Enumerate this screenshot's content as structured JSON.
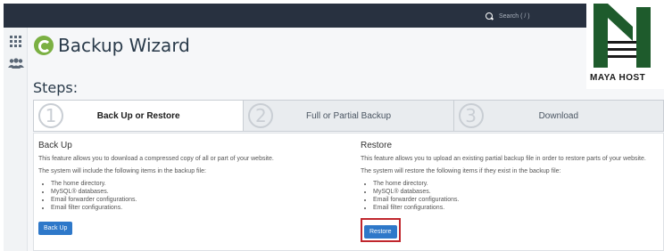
{
  "search": {
    "placeholder": "Search ( / )"
  },
  "page": {
    "title": "Backup Wizard",
    "steps_heading": "Steps:"
  },
  "steps": [
    {
      "number": "1",
      "label": "Back Up or Restore"
    },
    {
      "number": "2",
      "label": "Full or Partial Backup"
    },
    {
      "number": "3",
      "label": "Download"
    }
  ],
  "backup": {
    "heading": "Back Up",
    "description": "This feature allows you to download a compressed copy of all or part of your website.",
    "list_intro": "The system will include the following items in the backup file:",
    "items": [
      "The home directory.",
      "MySQL® databases.",
      "Email forwarder configurations.",
      "Email filter configurations."
    ],
    "button_label": "Back Up"
  },
  "restore": {
    "heading": "Restore",
    "description": "This feature allows you to upload an existing partial backup file in order to restore parts of your website.",
    "list_intro": "The system will restore the following items if they exist in the backup file:",
    "items": [
      "The home directory.",
      "MySQL® databases.",
      "Email forwarder configurations.",
      "Email filter configurations."
    ],
    "button_label": "Restore"
  },
  "brand": {
    "name": "MAYA HOST"
  },
  "colors": {
    "topbar": "#283140",
    "button": "#2e78c9",
    "highlight": "#c0262d",
    "logo_green": "#7bb043",
    "brand_green": "#1e5b2c"
  }
}
